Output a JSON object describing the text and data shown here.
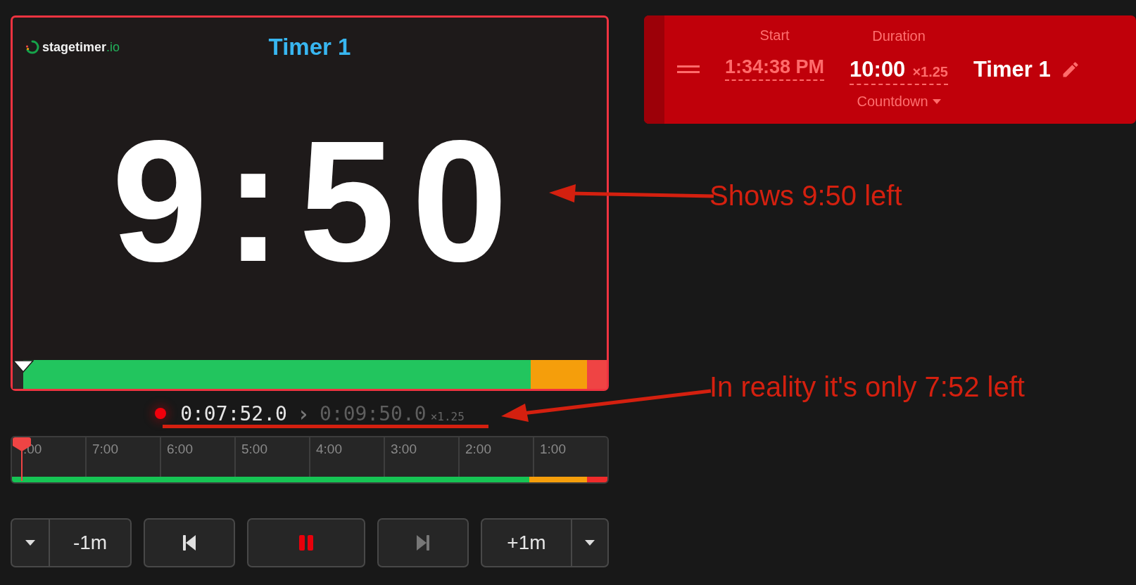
{
  "preview": {
    "logo": {
      "name": "stagetimer",
      "suffix": ".io"
    },
    "title": "Timer 1",
    "display": "9:50",
    "progress": {
      "level": 0.018,
      "zones": [
        {
          "kind": "main",
          "color": "#22c55e"
        },
        {
          "kind": "warning",
          "color": "#f59e0b"
        },
        {
          "kind": "danger",
          "color": "#ef4444"
        }
      ]
    }
  },
  "timecode": {
    "recording": true,
    "actual": "0:07:52.0",
    "separator": "›",
    "displayed": "0:09:50.0",
    "factor": "×1.25"
  },
  "timeline": {
    "level": 0.017,
    "ticks": [
      ":00",
      "7:00",
      "6:00",
      "5:00",
      "4:00",
      "3:00",
      "2:00",
      "1:00"
    ],
    "zones": [
      {
        "kind": "main",
        "color": "#16c454"
      },
      {
        "kind": "warning",
        "color": "#f59e0b"
      },
      {
        "kind": "danger",
        "color": "#ef2b2b"
      }
    ]
  },
  "controls": {
    "minus": "-1m",
    "plus": "+1m",
    "running": true,
    "previous_disabled": false,
    "next_disabled": true
  },
  "timer_card": {
    "start_label": "Start",
    "start": "1:34:38 PM",
    "duration_label": "Duration",
    "duration": "10:00",
    "factor": "×1.25",
    "mode": "Countdown",
    "name": "Timer 1"
  },
  "annotations": [
    {
      "text": "Shows 9:50 left"
    },
    {
      "text": "In reality it's only 7:52 left"
    }
  ]
}
